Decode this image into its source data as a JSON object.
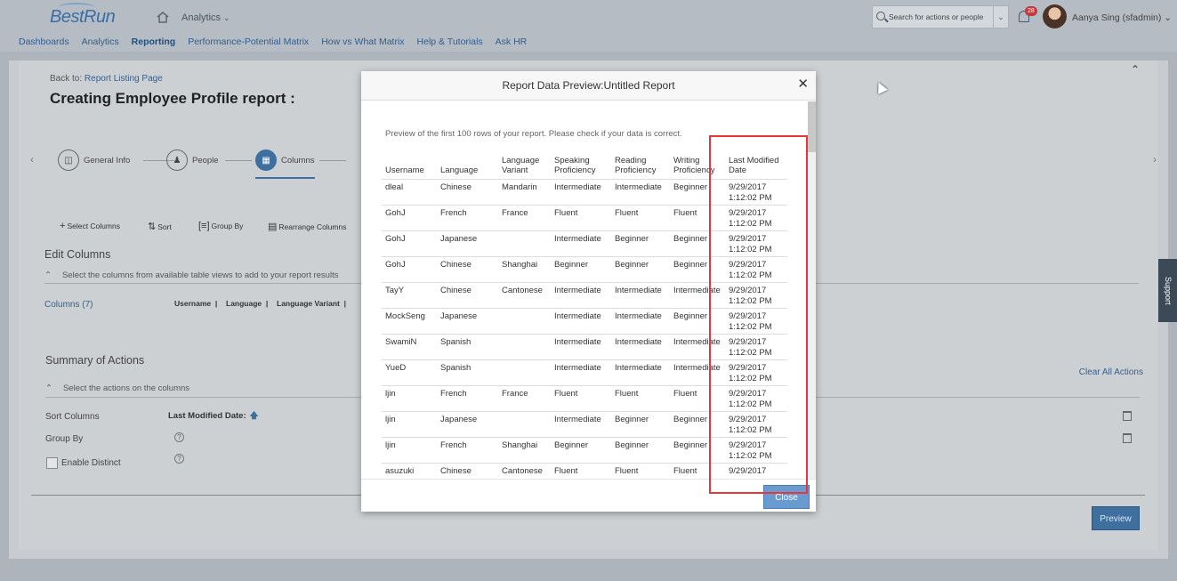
{
  "shell": {
    "logo": "BestRun",
    "module": "Analytics",
    "search_placeholder": "Search for actions or people",
    "notifications_count": "28",
    "user_name": "Aanya Sing (sfadmin)",
    "nav": [
      "Dashboards",
      "Analytics",
      "Reporting",
      "Performance-Potential Matrix",
      "How vs What Matrix",
      "Help & Tutorials",
      "Ask HR"
    ],
    "nav_active": "Reporting"
  },
  "page": {
    "back_label": "Back to:",
    "back_link": "Report Listing Page",
    "title": "Creating Employee Profile report :",
    "steps": [
      "General Info",
      "People",
      "Columns"
    ],
    "toolbar": [
      "Select Columns",
      "Sort",
      "Group By",
      "Rearrange Columns"
    ],
    "edit_columns_title": "Edit Columns",
    "edit_columns_sub": "Select the columns from available table views to add to your report results",
    "columns_label": "Columns (7)",
    "column_chips": [
      "Username",
      "Language",
      "Language Variant"
    ],
    "summary_title": "Summary of Actions",
    "summary_sub": "Select the actions on the columns",
    "clear_all": "Clear All Actions",
    "sort_columns_label": "Sort Columns",
    "sort_value": "Last Modified Date:",
    "group_by_label": "Group By",
    "distinct_label": "Enable Distinct",
    "preview_button": "Preview",
    "support": "Support"
  },
  "modal": {
    "title": "Report Data Preview:Untitled Report",
    "intro": "Preview of the first 100 rows of your report. Please check if your data is correct.",
    "headers": [
      [
        "Username"
      ],
      [
        "Language"
      ],
      [
        "Language",
        "Variant"
      ],
      [
        "Speaking",
        "Proficiency"
      ],
      [
        "Reading",
        "Proficiency"
      ],
      [
        "Writing",
        "Proficiency"
      ],
      [
        "Last Modified",
        "Date"
      ]
    ],
    "rows": [
      [
        "dleal",
        "Chinese",
        "Mandarin",
        "Intermediate",
        "Intermediate",
        "Beginner",
        "9/29/2017",
        "1:12:02 PM"
      ],
      [
        "GohJ",
        "French",
        "France",
        "Fluent",
        "Fluent",
        "Fluent",
        "9/29/2017",
        "1:12:02 PM"
      ],
      [
        "GohJ",
        "Japanese",
        "",
        "Intermediate",
        "Beginner",
        "Beginner",
        "9/29/2017",
        "1:12:02 PM"
      ],
      [
        "GohJ",
        "Chinese",
        "Shanghai",
        "Beginner",
        "Beginner",
        "Beginner",
        "9/29/2017",
        "1:12:02 PM"
      ],
      [
        "TayY",
        "Chinese",
        "Cantonese",
        "Intermediate",
        "Intermediate",
        "Intermediate",
        "9/29/2017",
        "1:12:02 PM"
      ],
      [
        "MockSeng",
        "Japanese",
        "",
        "Intermediate",
        "Intermediate",
        "Beginner",
        "9/29/2017",
        "1:12:02 PM"
      ],
      [
        "SwamiN",
        "Spanish",
        "",
        "Intermediate",
        "Intermediate",
        "Intermediate",
        "9/29/2017",
        "1:12:02 PM"
      ],
      [
        "YueD",
        "Spanish",
        "",
        "Intermediate",
        "Intermediate",
        "Intermediate",
        "9/29/2017",
        "1:12:02 PM"
      ],
      [
        "ljin",
        "French",
        "France",
        "Fluent",
        "Fluent",
        "Fluent",
        "9/29/2017",
        "1:12:02 PM"
      ],
      [
        "ljin",
        "Japanese",
        "",
        "Intermediate",
        "Beginner",
        "Beginner",
        "9/29/2017",
        "1:12:02 PM"
      ],
      [
        "ljin",
        "French",
        "Shanghai",
        "Beginner",
        "Beginner",
        "Beginner",
        "9/29/2017",
        "1:12:02 PM"
      ],
      [
        "asuzuki",
        "Chinese",
        "Cantonese",
        "Fluent",
        "Fluent",
        "Fluent",
        "9/29/2017",
        ""
      ]
    ],
    "close_button": "Close"
  }
}
